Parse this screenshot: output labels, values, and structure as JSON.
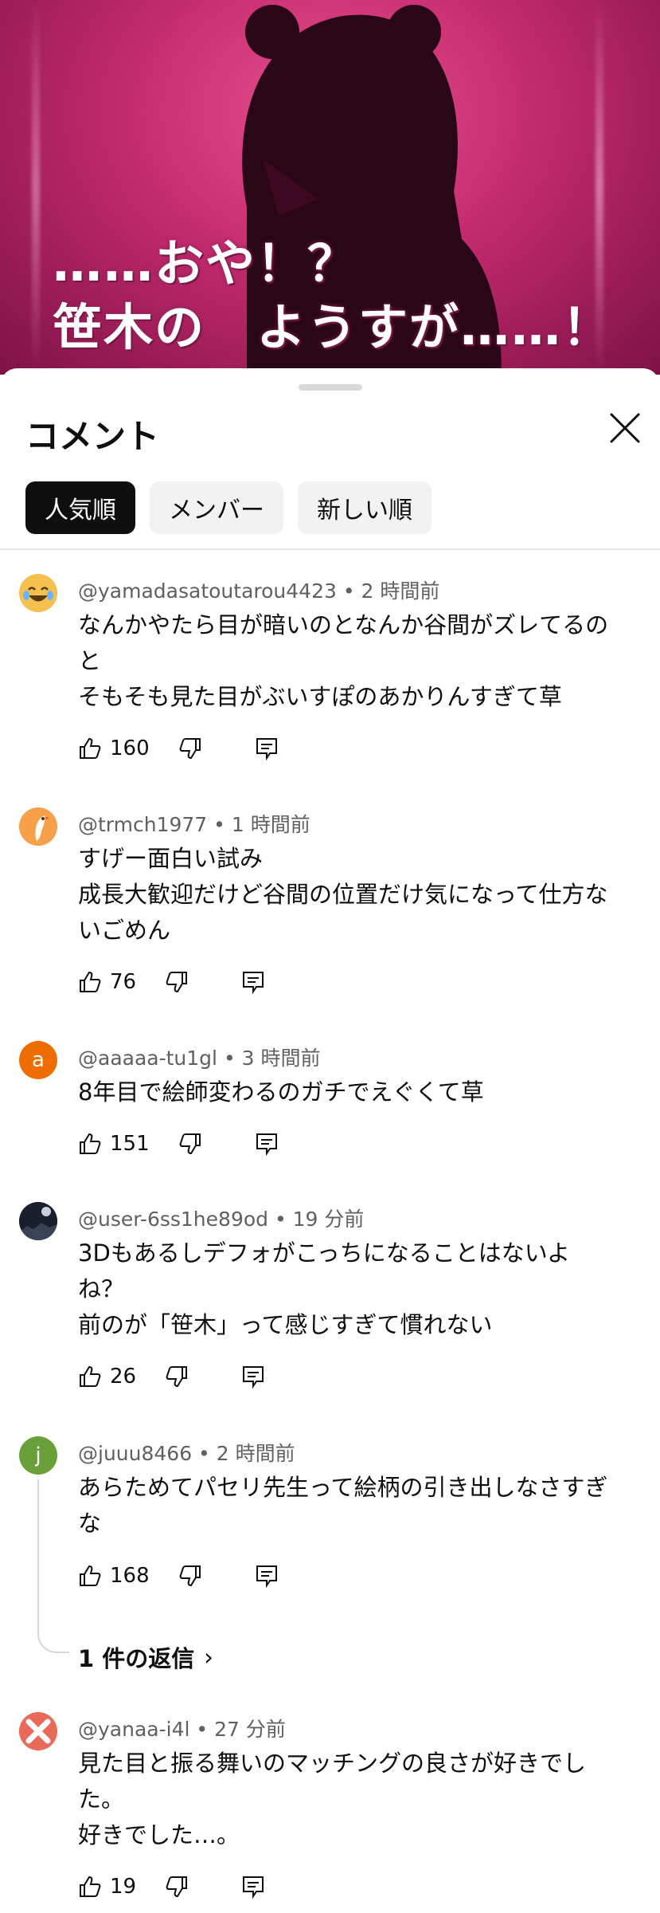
{
  "video": {
    "caption_line1": "……おや！？",
    "caption_line2": "笹木の　ようすが……！"
  },
  "sheet": {
    "title": "コメント",
    "chips": [
      "人気順",
      "メンバー",
      "新しい順"
    ]
  },
  "comments": [
    {
      "author": "@yamadasatoutarou4423",
      "time": "2 時間前",
      "lines": [
        "なんかやたら目が暗いのとなんか谷間がズレてるの",
        "と",
        "そもそも見た目がぶいすぽのあかりんすぎて草"
      ],
      "likes": "160",
      "avatar": {
        "type": "emoji-laugh",
        "color": "#e8a23a"
      }
    },
    {
      "author": "@trmch1977",
      "time": "1 時間前",
      "lines": [
        "すげー面白い試み",
        "成長大歓迎だけど谷間の位置だけ気になって仕方な",
        "いごめん"
      ],
      "likes": "76",
      "avatar": {
        "type": "bird",
        "color": "#f0a040"
      }
    },
    {
      "author": "@aaaaa-tu1gl",
      "time": "3 時間前",
      "lines": [
        "8年目で絵師変わるのガチでえぐくて草"
      ],
      "likes": "151",
      "avatar": {
        "type": "letter",
        "letter": "a",
        "color": "#ef6c00"
      }
    },
    {
      "author": "@user-6ss1he89od",
      "time": "19 分前",
      "lines": [
        "3Dもあるしデフォがこっちになることはないよ",
        "ね？",
        "前のが「笹木」って感じすぎて慣れない"
      ],
      "likes": "26",
      "avatar": {
        "type": "night",
        "color": "#1c2230"
      }
    },
    {
      "author": "@juuu8466",
      "time": "2 時間前",
      "lines": [
        "あらためてパセリ先生って絵柄の引き出しなさすぎ",
        "な"
      ],
      "likes": "168",
      "avatar": {
        "type": "letter",
        "letter": "j",
        "color": "#689f38"
      },
      "replies_label": "1 件の返信"
    },
    {
      "author": "@yanaa-i4l",
      "time": "27 分前",
      "lines": [
        "見た目と振る舞いのマッチングの良さが好きでし",
        "た。",
        "好きでした…。"
      ],
      "likes": "19",
      "avatar": {
        "type": "cross",
        "color": "#e9695a"
      }
    }
  ]
}
